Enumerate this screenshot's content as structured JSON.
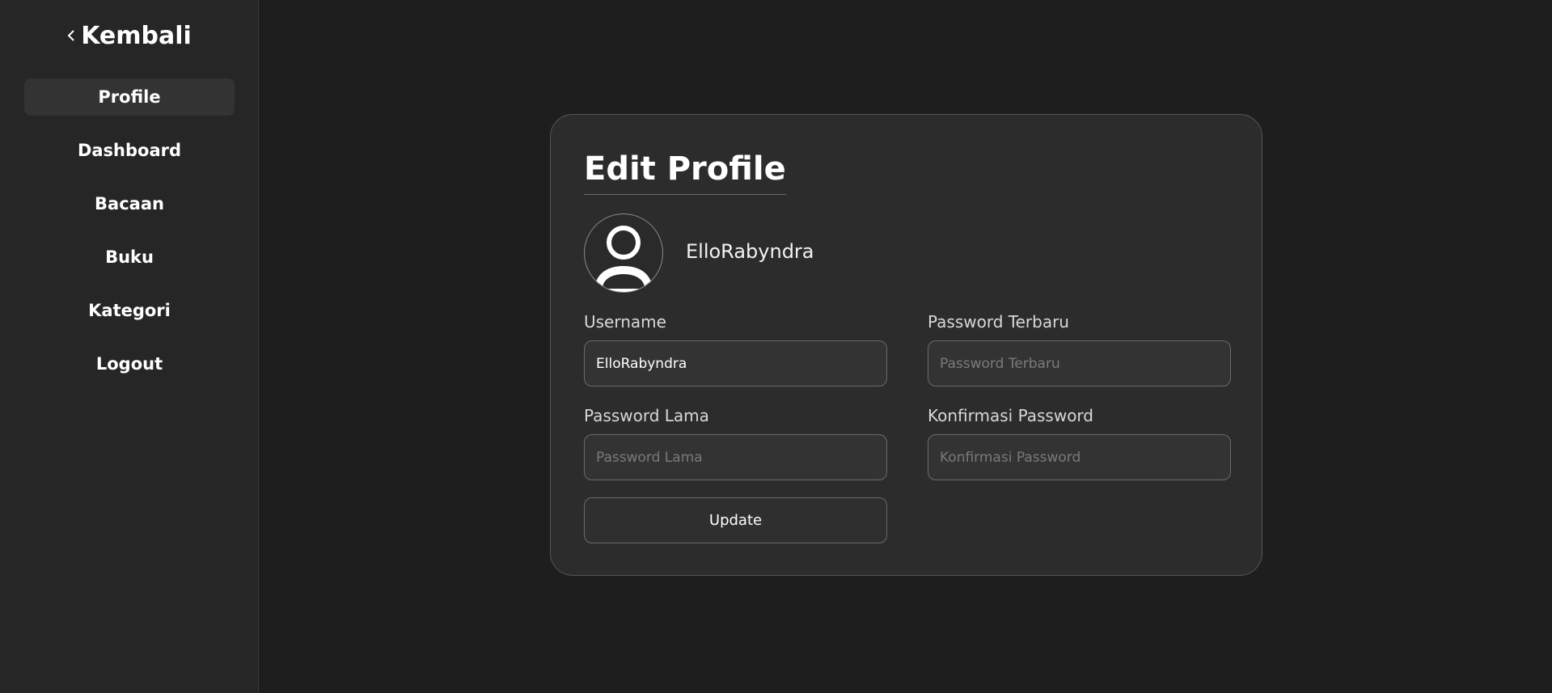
{
  "sidebar": {
    "back_label": "Kembali",
    "back_icon": "chevron-left-icon",
    "items": [
      {
        "label": "Profile",
        "active": true
      },
      {
        "label": "Dashboard",
        "active": false
      },
      {
        "label": "Bacaan",
        "active": false
      },
      {
        "label": "Buku",
        "active": false
      },
      {
        "label": "Kategori",
        "active": false
      },
      {
        "label": "Logout",
        "active": false
      }
    ]
  },
  "card": {
    "title": "Edit Profile",
    "avatar_icon": "user-avatar-icon",
    "display_name": "ElloRabyndra",
    "fields": {
      "username": {
        "label": "Username",
        "value": "ElloRabyndra",
        "placeholder": ""
      },
      "new_password": {
        "label": "Password Terbaru",
        "value": "",
        "placeholder": "Password Terbaru"
      },
      "old_password": {
        "label": "Password Lama",
        "value": "",
        "placeholder": "Password Lama"
      },
      "confirm_password": {
        "label": "Konfirmasi Password",
        "value": "",
        "placeholder": "Konfirmasi Password"
      }
    },
    "update_label": "Update"
  },
  "colors": {
    "background": "#1e1e1e",
    "sidebar": "#262626",
    "card": "#2c2c2c",
    "active_item": "#333333",
    "border": "#6a6a6a"
  }
}
